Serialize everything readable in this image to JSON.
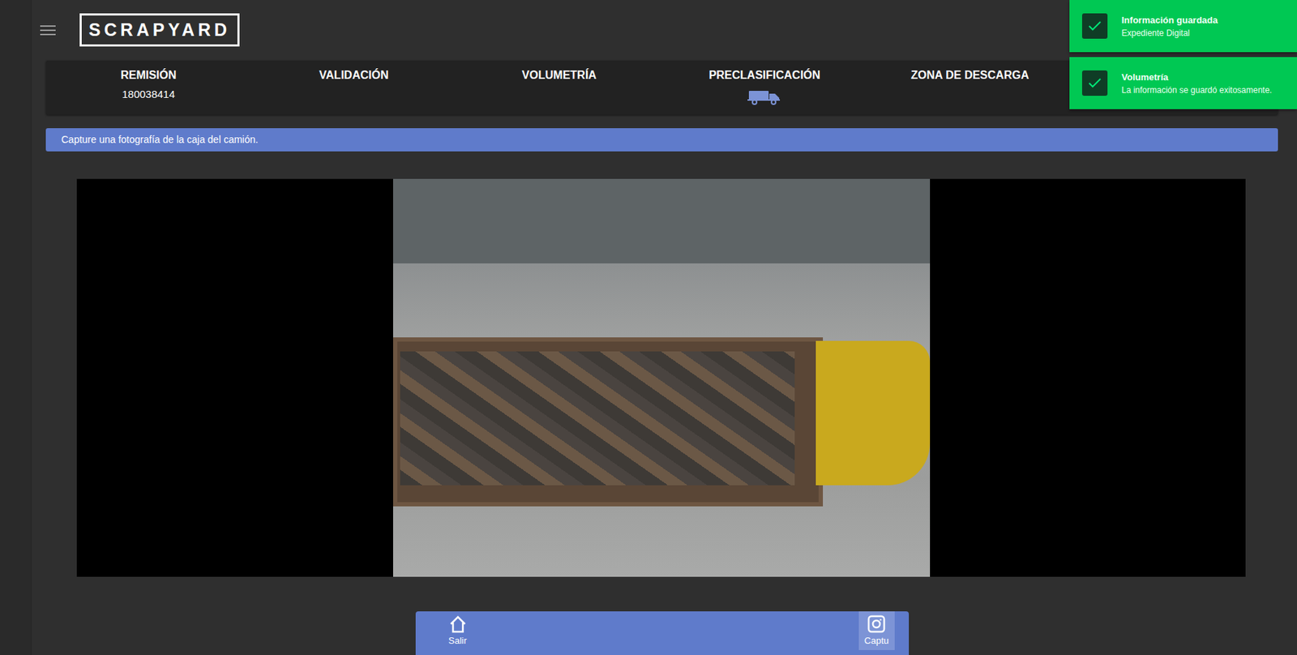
{
  "header": {
    "logo": "SCRAPYARD"
  },
  "steps": [
    {
      "label": "REMISIÓN",
      "value": "180038414",
      "selected": false
    },
    {
      "label": "VALIDACIÓN",
      "selected": false
    },
    {
      "label": "VOLUMETRÍA",
      "selected": false
    },
    {
      "label": "PRECLASIFICACIÓN",
      "selected": true
    },
    {
      "label": "ZONA DE DESCARGA",
      "selected": false
    }
  ],
  "instruction": "Capture una fotografía de la caja del camión.",
  "toolbar": {
    "buttons": [
      {
        "label": "Salir",
        "kind": "home",
        "hovered": false
      },
      {
        "label": "Captu",
        "kind": "capture",
        "hovered": true
      }
    ]
  },
  "notifications": [
    {
      "title": "Información guardada",
      "message": "Expediente Digital"
    },
    {
      "title": "Volumetría",
      "message": "La información se guardó exitosamente."
    }
  ]
}
